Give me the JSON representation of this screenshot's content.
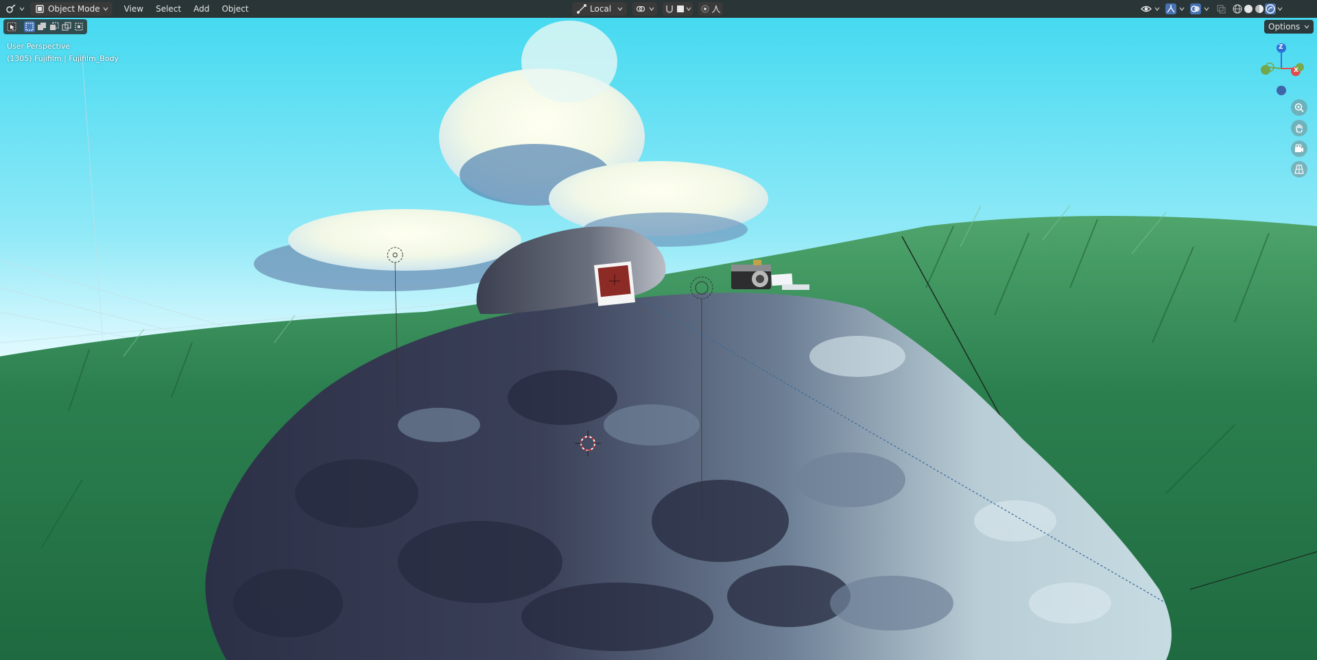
{
  "header": {
    "editor_type_icon": "editor-type-icon",
    "mode": {
      "label": "Object Mode",
      "icon": "object-mode-icon"
    },
    "menus": [
      "View",
      "Select",
      "Add",
      "Object"
    ],
    "transform_orientation": {
      "label": "Local",
      "icon": "orientation-icon"
    },
    "pivot_icon": "pivot-icon",
    "snap_icon": "snap-magnet-icon",
    "snap_target_icon": "snap-square-icon",
    "proportional_icons": [
      "proportional-edit-icon",
      "falloff-curve-icon"
    ],
    "right_icons": [
      "visibility-icon",
      "gizmo-icon",
      "overlay-icon",
      "xray-icon",
      "shading-wireframe-icon",
      "shading-solid-icon",
      "shading-material-icon",
      "shading-rendered-icon"
    ]
  },
  "toolbar": {
    "select_modes": [
      "select-box-icon",
      "mode-new-icon",
      "mode-extend-icon",
      "mode-subtract-icon",
      "mode-intersect-icon"
    ]
  },
  "viewport": {
    "view_name": "User Perspective",
    "object_info": "(1305) Fujifilm | Fujifilm_Body",
    "options_label": "Options",
    "axes": {
      "z": "Z",
      "x": "X"
    },
    "nav_icons": [
      "zoom-icon",
      "pan-hand-icon",
      "camera-view-icon",
      "perspective-grid-icon"
    ]
  },
  "colors": {
    "header_bg": "#282828",
    "sky_top": "#45dcf2",
    "grass": "#2a7a4a",
    "rock_dark": "#333850",
    "rock_light": "#b8ccd4",
    "axis_z": "#2f6fd6",
    "axis_x": "#e34b4b",
    "axis_y": "#74a64a",
    "active_blue": "#4772b3"
  }
}
